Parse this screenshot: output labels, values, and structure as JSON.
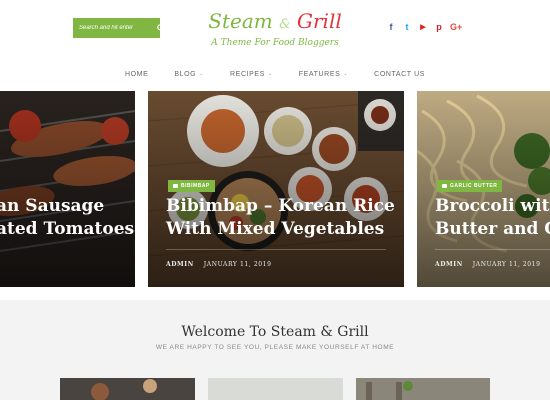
{
  "header": {
    "search_placeholder": "Search and hit enter",
    "logo_part1": "Steam",
    "logo_amp": "&",
    "logo_part2": "Grill",
    "tagline": "A Theme For Food Bloggers",
    "social": [
      {
        "icon": "facebook-icon",
        "glyph": "f",
        "color": "#3b5998"
      },
      {
        "icon": "twitter-icon",
        "glyph": "t",
        "color": "#1da1f2"
      },
      {
        "icon": "youtube-icon",
        "glyph": "▶",
        "color": "#e62117"
      },
      {
        "icon": "pinterest-icon",
        "glyph": "p",
        "color": "#cb2027"
      },
      {
        "icon": "google-plus-icon",
        "glyph": "G+",
        "color": "#dd4b39"
      }
    ]
  },
  "nav": [
    {
      "label": "Home",
      "dropdown": false
    },
    {
      "label": "Blog",
      "dropdown": true
    },
    {
      "label": "Recipes",
      "dropdown": true
    },
    {
      "label": "Features",
      "dropdown": true
    },
    {
      "label": "Contact Us",
      "dropdown": false
    }
  ],
  "slides": [
    {
      "title_line1": "an Sausage",
      "title_line2": "ated Tomatoes"
    },
    {
      "badge": "BIBIMBAP",
      "title_line1": "Bibimbap – Korean Rice",
      "title_line2": "With Mixed Vegetables",
      "author": "ADMIN",
      "date": "JANUARY 11, 2019"
    },
    {
      "badge": "GARLIC BUTTER",
      "title_line1": "Broccoli with",
      "title_line2": "Butter and Ca",
      "author": "ADMIN",
      "date": "JANUARY 11, 2019"
    }
  ],
  "welcome": {
    "title": "Welcome To Steam & Grill",
    "subtitle": "WE ARE HAPPY TO SEE YOU, PLEASE MAKE YOURSELF AT HOME"
  },
  "colors": {
    "accent": "#7fb742",
    "logo_red": "#e0363b"
  }
}
